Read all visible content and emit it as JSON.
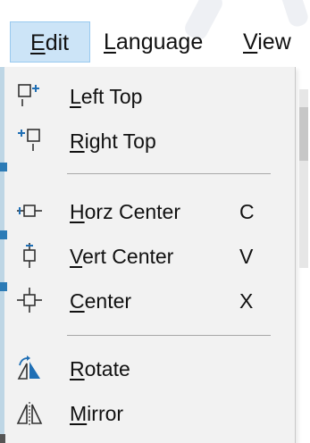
{
  "menubar": {
    "items": [
      {
        "label_first": "E",
        "label_rest": "dit",
        "active": true
      },
      {
        "label_first": "L",
        "label_rest": "anguage",
        "active": false
      },
      {
        "label_first": "V",
        "label_rest": "iew",
        "active": false
      }
    ]
  },
  "menu": {
    "items": [
      {
        "mn": "L",
        "rest": "eft Top",
        "shortcut": "",
        "icon": "left-top-icon"
      },
      {
        "mn": "R",
        "rest": "ight Top",
        "shortcut": "",
        "icon": "right-top-icon"
      },
      {
        "mn": "H",
        "rest": "orz Center",
        "shortcut": "C",
        "icon": "horz-center-icon"
      },
      {
        "mn": "V",
        "rest": "ert Center",
        "shortcut": "V",
        "icon": "vert-center-icon"
      },
      {
        "mn": "C",
        "rest": "enter",
        "shortcut": "X",
        "icon": "center-icon"
      },
      {
        "mn": "R",
        "rest": "otate",
        "shortcut": "",
        "icon": "rotate-icon"
      },
      {
        "mn": "M",
        "rest": "irror",
        "shortcut": "",
        "icon": "mirror-icon"
      }
    ]
  },
  "colors": {
    "menu_bg": "#f2f2f2",
    "active_bg": "#cce4f7",
    "active_border": "#99c9ef",
    "separator": "#a8a8a8",
    "icon_blue": "#1f6fb5",
    "icon_dark": "#333333"
  }
}
